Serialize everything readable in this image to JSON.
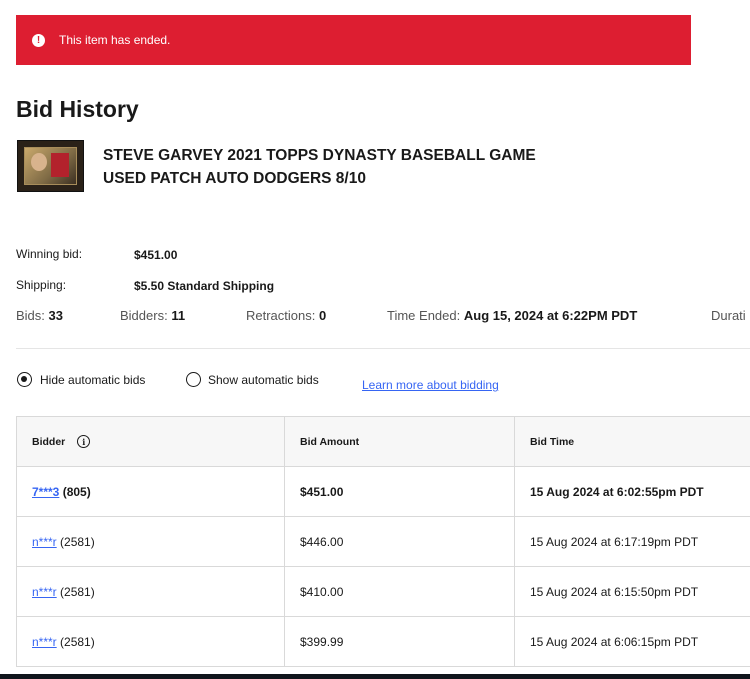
{
  "banner": {
    "icon": "alert-icon",
    "message": "This item has ended.",
    "color": "#dd1e31"
  },
  "page_title": "Bid History",
  "item": {
    "title_line1": "STEVE GARVEY 2021 TOPPS DYNASTY BASEBALL GAME",
    "title_line2": "USED PATCH AUTO DODGERS 8/10"
  },
  "info": {
    "winning_bid_label": "Winning bid:",
    "winning_bid_value": "$451.00",
    "shipping_label": "Shipping:",
    "shipping_value": "$5.50 Standard Shipping"
  },
  "stats": {
    "bids_label": "Bids:",
    "bids_value": "33",
    "bidders_label": "Bidders:",
    "bidders_value": "11",
    "retractions_label": "Retractions:",
    "retractions_value": "0",
    "time_ended_label": "Time Ended:",
    "time_ended_value": "Aug 15, 2024 at 6:22PM PDT",
    "duration_label": "Durati"
  },
  "options": {
    "hide_label": "Hide automatic bids",
    "show_label": "Show automatic bids",
    "learn_more": "Learn more about bidding"
  },
  "table": {
    "headers": {
      "bidder": "Bidder",
      "amount": "Bid Amount",
      "time": "Bid Time"
    },
    "rows": [
      {
        "bidder": "7***3",
        "feedback": "(805)",
        "amount": "$451.00",
        "time": "15 Aug 2024 at 6:02:55pm PDT"
      },
      {
        "bidder": "n***r",
        "feedback": "(2581)",
        "amount": "$446.00",
        "time": "15 Aug 2024 at 6:17:19pm PDT"
      },
      {
        "bidder": "n***r",
        "feedback": "(2581)",
        "amount": "$410.00",
        "time": "15 Aug 2024 at 6:15:50pm PDT"
      },
      {
        "bidder": "n***r",
        "feedback": "(2581)",
        "amount": "$399.99",
        "time": "15 Aug 2024 at 6:06:15pm PDT"
      }
    ]
  },
  "colors": {
    "link": "#3665f3",
    "text": "#191919"
  }
}
